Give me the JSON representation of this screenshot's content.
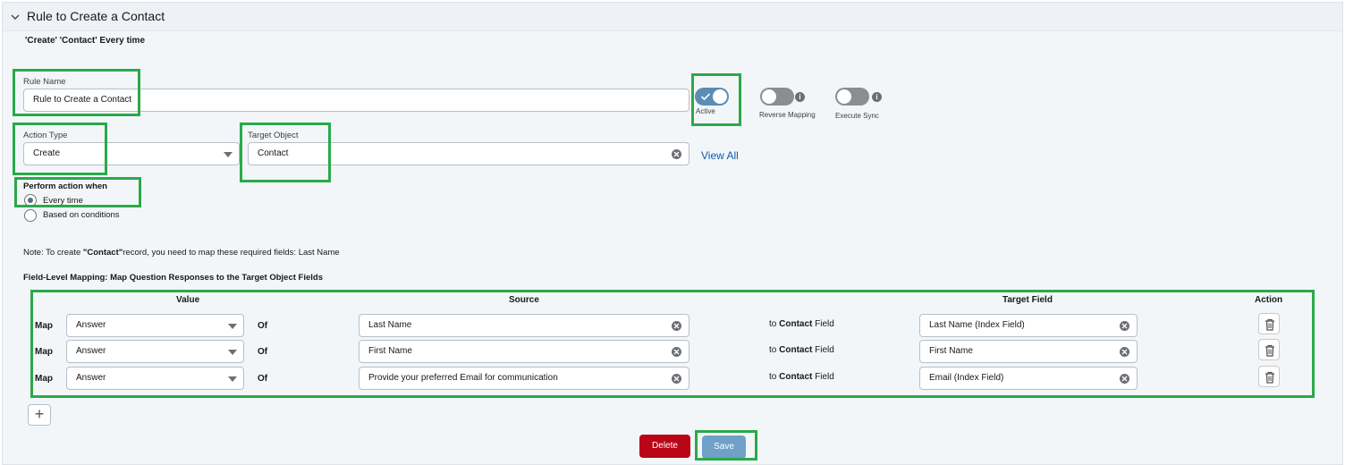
{
  "header": {
    "title": "Rule to Create a Contact"
  },
  "summary": "'Create' 'Contact' Every time",
  "rule_name": {
    "label": "Rule Name",
    "value": "Rule to Create a Contact"
  },
  "toggles": {
    "active": {
      "label": "Active",
      "on": true
    },
    "reverse_mapping": {
      "label": "Reverse Mapping",
      "on": false
    },
    "execute_sync": {
      "label": "Execute Sync",
      "on": false
    }
  },
  "action_type": {
    "label": "Action Type",
    "value": "Create"
  },
  "target_object": {
    "label": "Target Object",
    "value": "Contact"
  },
  "view_all": "View All",
  "perform": {
    "label": "Perform action when",
    "options": [
      "Every time",
      "Based on conditions"
    ],
    "selected": "Every time"
  },
  "note": {
    "prefix": "Note: To create ",
    "object": "\"Contact\"",
    "suffix": "record, you need to map these required fields: Last Name"
  },
  "mapping": {
    "title": "Field-Level Mapping: Map Question Responses to the Target Object Fields",
    "headers": {
      "value": "Value",
      "source": "Source",
      "target": "Target Field",
      "action": "Action"
    },
    "map_label": "Map",
    "of_label": "Of",
    "to_prefix": "to ",
    "to_object": "Contact",
    "to_suffix": " Field",
    "rows": [
      {
        "value": "Answer",
        "source": "Last Name",
        "target": "Last Name (Index Field)"
      },
      {
        "value": "Answer",
        "source": "First Name",
        "target": "First Name"
      },
      {
        "value": "Answer",
        "source": "Provide your preferred Email for communication",
        "target": "Email (Index Field)"
      }
    ],
    "add_label": "+"
  },
  "buttons": {
    "delete": "Delete",
    "save": "Save"
  },
  "colors": {
    "highlight": "#2aa94a",
    "delete": "#ba0517",
    "save": "#6fa0c8",
    "toggle_on": "#5b8cb3",
    "link": "#0b5cab"
  },
  "icons": [
    "chevron-down-icon",
    "check-icon",
    "info-icon",
    "clear-icon",
    "dropdown-caret-icon",
    "trash-icon",
    "plus-icon"
  ]
}
